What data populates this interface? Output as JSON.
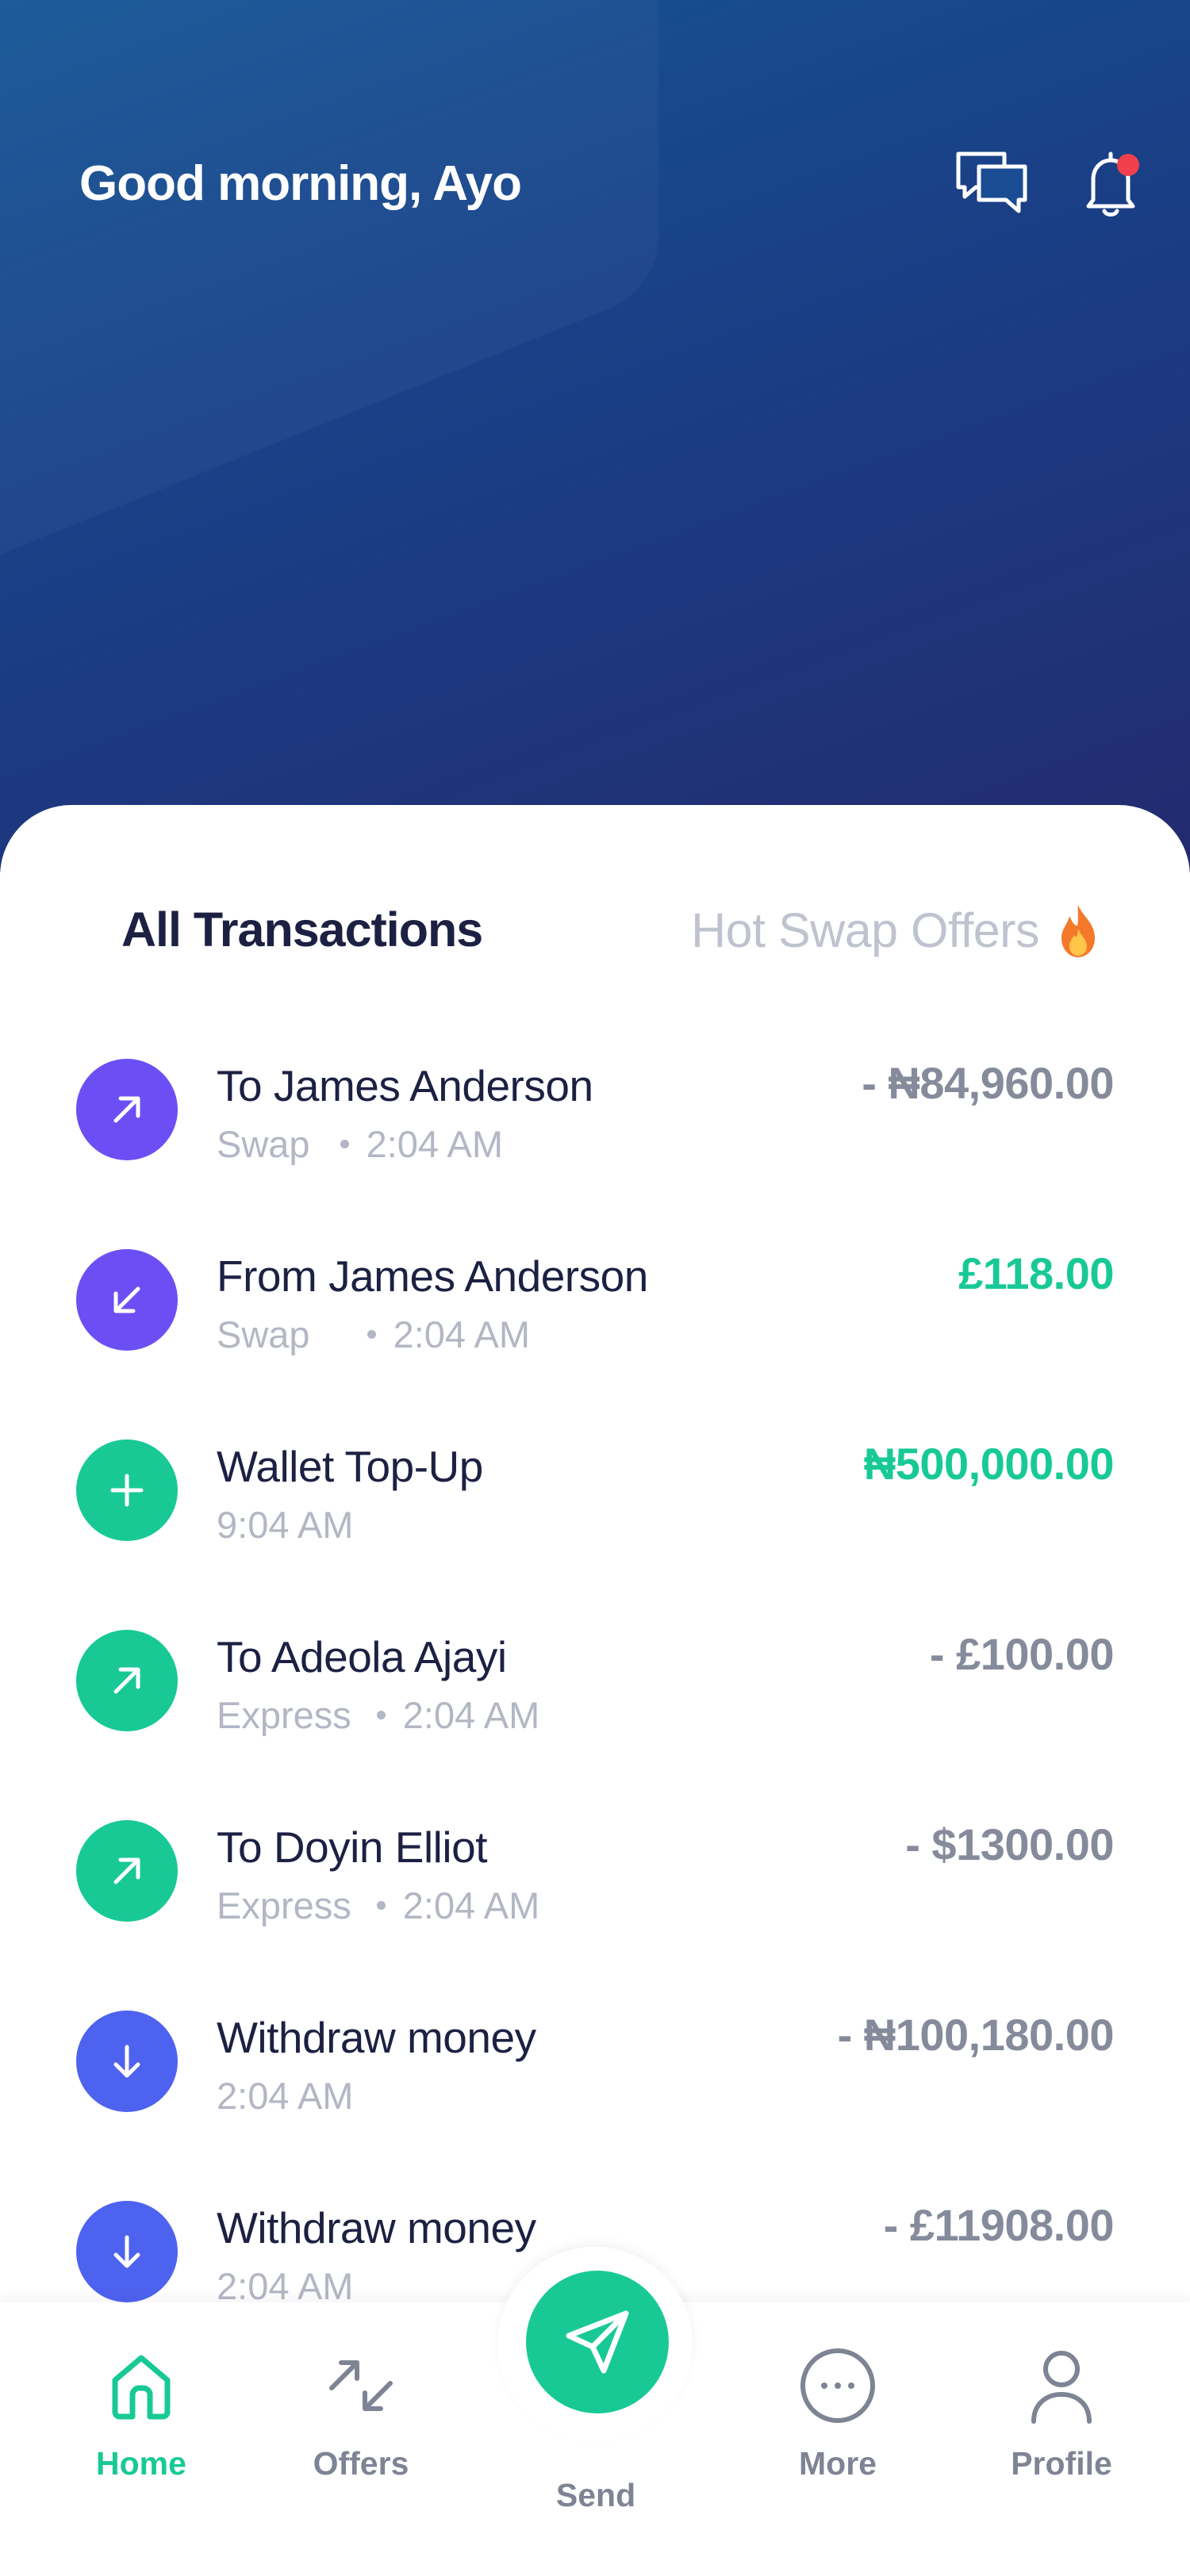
{
  "header": {
    "greeting": "Good morning, Ayo",
    "icons": [
      "chat-icon",
      "bell-icon"
    ],
    "has_notification": true
  },
  "tabs": {
    "active": "All Transactions",
    "inactive": "Hot Swap Offers",
    "inactive_icon": "fire-icon"
  },
  "transactions": [
    {
      "title": "To James Anderson",
      "type": "Swap",
      "time": "2:04 AM",
      "amount": "- ₦84,960.00",
      "direction": "outgoing",
      "icon": "arrow-up-right-icon",
      "color": "#6c4ff4"
    },
    {
      "title": "From James Anderson",
      "type": "Swap",
      "time": "2:04 AM",
      "amount": "£118.00",
      "direction": "incoming",
      "icon": "arrow-down-left-icon",
      "color": "#6c4ff4"
    },
    {
      "title": "Wallet Top-Up",
      "type": "",
      "time": "9:04 AM",
      "amount": "₦500,000.00",
      "direction": "incoming",
      "icon": "plus-icon",
      "color": "#18c996"
    },
    {
      "title": "To Adeola Ajayi",
      "type": "Express",
      "time": "2:04 AM",
      "amount": "- £100.00",
      "direction": "outgoing",
      "icon": "arrow-up-right-icon",
      "color": "#18c996"
    },
    {
      "title": "To Doyin Elliot",
      "type": "Express",
      "time": "2:04 AM",
      "amount": "- $1300.00",
      "direction": "outgoing",
      "icon": "arrow-up-right-icon",
      "color": "#18c996"
    },
    {
      "title": "Withdraw money",
      "type": "",
      "time": "2:04 AM",
      "amount": "- ₦100,180.00",
      "direction": "outgoing",
      "icon": "arrow-down-icon",
      "color": "#4e62f0"
    },
    {
      "title": "Withdraw money",
      "type": "",
      "time": "2:04 AM",
      "amount": "- £11908.00",
      "direction": "outgoing",
      "icon": "arrow-down-icon",
      "color": "#4e62f0"
    }
  ],
  "nav": {
    "home": "Home",
    "offers": "Offers",
    "send": "Send",
    "more": "More",
    "profile": "Profile",
    "active": "Home"
  },
  "colors": {
    "accent": "#18c996",
    "header_gradient_start": "#155597",
    "header_gradient_end": "#232a6f",
    "text_dark": "#1c2143",
    "text_muted": "#b3b7c4",
    "amount_negative": "#858b9b",
    "notification": "#f1404b"
  }
}
